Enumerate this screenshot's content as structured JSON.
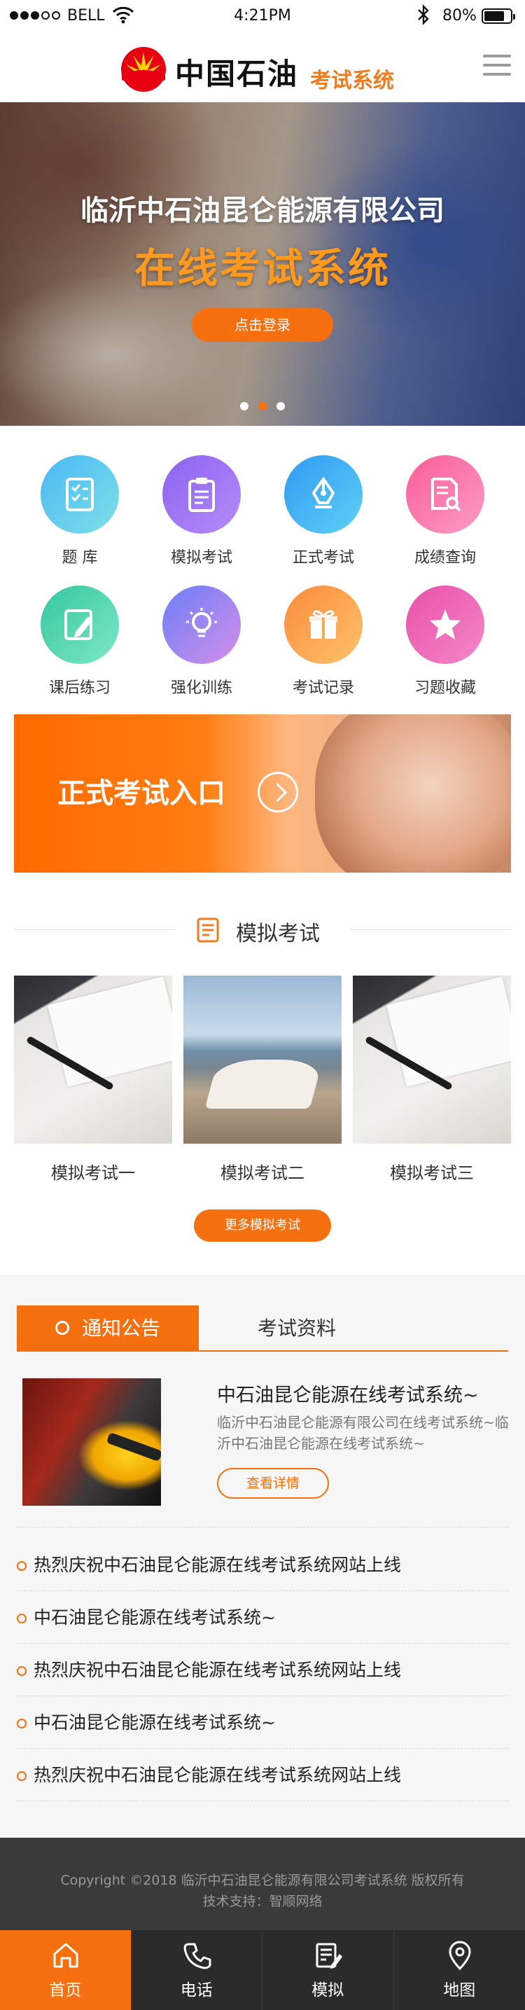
{
  "status_bar": {
    "carrier": "BELL",
    "time": "4:21PM",
    "battery": "80%"
  },
  "header": {
    "brand": "中国石油",
    "subtitle": "考试系统"
  },
  "banner": {
    "line1": "临沂中石油昆仑能源有限公司",
    "line2": "在线考试系统",
    "login_label": "点击登录",
    "active_slide": 2,
    "slide_count": 3
  },
  "shortcuts": [
    {
      "label": "题 库",
      "icon": "question-bank-icon",
      "colors": [
        "#49b8f5",
        "#7fe0e6"
      ]
    },
    {
      "label": "模拟考试",
      "icon": "clipboard-icon",
      "colors": [
        "#8b63f0",
        "#b58cf8"
      ]
    },
    {
      "label": "正式考试",
      "icon": "pen-nib-icon",
      "colors": [
        "#2f9af2",
        "#5fd0f5"
      ]
    },
    {
      "label": "成绩查询",
      "icon": "document-search-icon",
      "colors": [
        "#fb5d99",
        "#f99cc6"
      ]
    },
    {
      "label": "课后练习",
      "icon": "pencil-icon",
      "colors": [
        "#34c7a0",
        "#7ee8c4"
      ]
    },
    {
      "label": "强化训练",
      "icon": "lightbulb-icon",
      "colors": [
        "#6b7ef7",
        "#d58fe9"
      ]
    },
    {
      "label": "考试记录",
      "icon": "gift-box-icon",
      "colors": [
        "#fb8a3c",
        "#fdc36a"
      ]
    },
    {
      "label": "习题收藏",
      "icon": "star-icon",
      "colors": [
        "#e950a7",
        "#f487c8"
      ]
    }
  ],
  "entry_banner": {
    "label": "正式考试入口"
  },
  "mock_section": {
    "title": "模拟考试",
    "items": [
      {
        "label": "模拟考试一",
        "image": "desk"
      },
      {
        "label": "模拟考试二",
        "image": "book"
      },
      {
        "label": "模拟考试三",
        "image": "desk"
      }
    ],
    "more_label": "更多模拟考试"
  },
  "notice": {
    "tabs": [
      "通知公告",
      "考试资料"
    ],
    "feature": {
      "title": "中石油昆仑能源在线考试系统~",
      "desc": "临沂中石油昆仑能源有限公司在线考试系统~临沂中石油昆仑能源在线考试系统~",
      "detail_label": "查看详情"
    },
    "list": [
      "热烈庆祝中石油昆仑能源在线考试系统网站上线",
      "中石油昆仑能源在线考试系统~",
      "热烈庆祝中石油昆仑能源在线考试系统网站上线",
      "中石油昆仑能源在线考试系统~",
      "热烈庆祝中石油昆仑能源在线考试系统网站上线"
    ]
  },
  "footer": {
    "copyright": "Copyright ©2018 临沂中石油昆仑能源有限公司考试系统 版权所有",
    "support": "技术支持：智顺网络"
  },
  "tabbar": [
    {
      "label": "首页",
      "icon": "home-icon",
      "active": true
    },
    {
      "label": "电话",
      "icon": "phone-icon",
      "active": false
    },
    {
      "label": "模拟",
      "icon": "edit-icon",
      "active": false
    },
    {
      "label": "地图",
      "icon": "map-pin-icon",
      "active": false
    }
  ],
  "colors": {
    "accent": "#f7700f",
    "footer_bg": "#3a3a3a",
    "tabbar_bg": "#2b2b2b"
  }
}
